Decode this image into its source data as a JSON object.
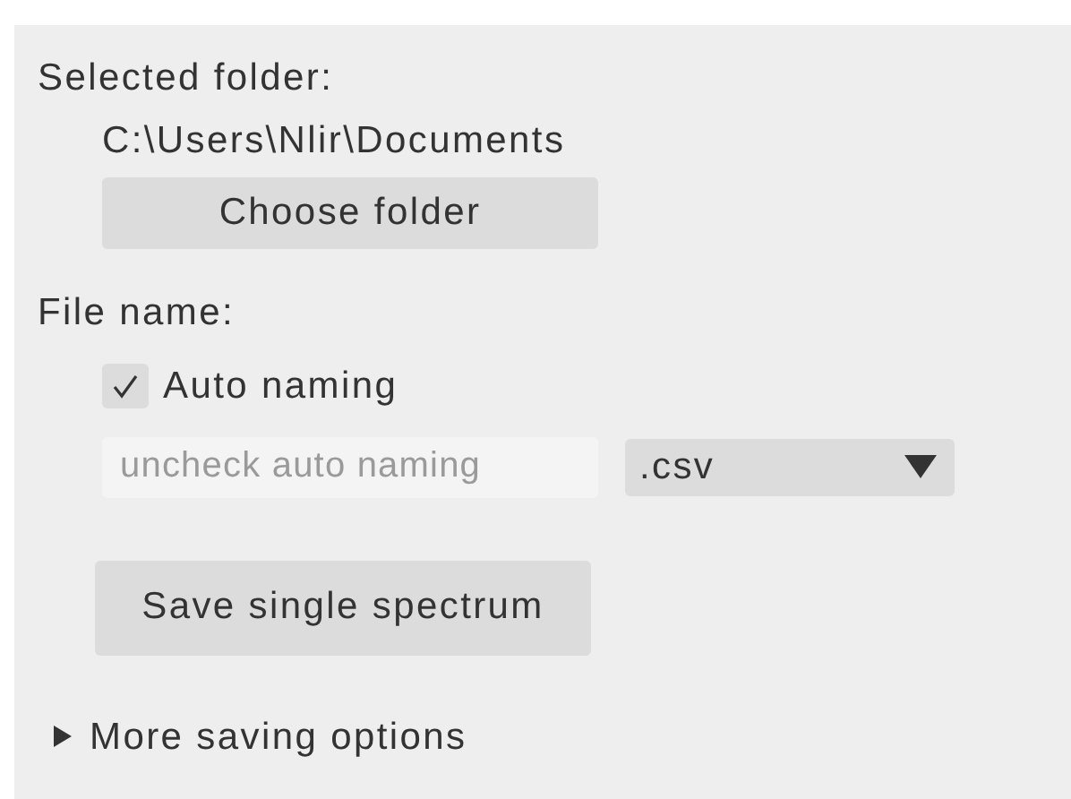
{
  "folder": {
    "label": "Selected folder:",
    "path": "C:\\Users\\Nlir\\Documents",
    "button": "Choose folder"
  },
  "file_name": {
    "label": "File name:",
    "auto_naming": {
      "label": "Auto naming",
      "checked": true
    },
    "name_field": {
      "placeholder": "uncheck auto naming",
      "disabled": true
    },
    "extension": {
      "value": ".csv"
    }
  },
  "save_button": "Save single spectrum",
  "more_options": {
    "label": "More saving options",
    "expanded": false
  }
}
